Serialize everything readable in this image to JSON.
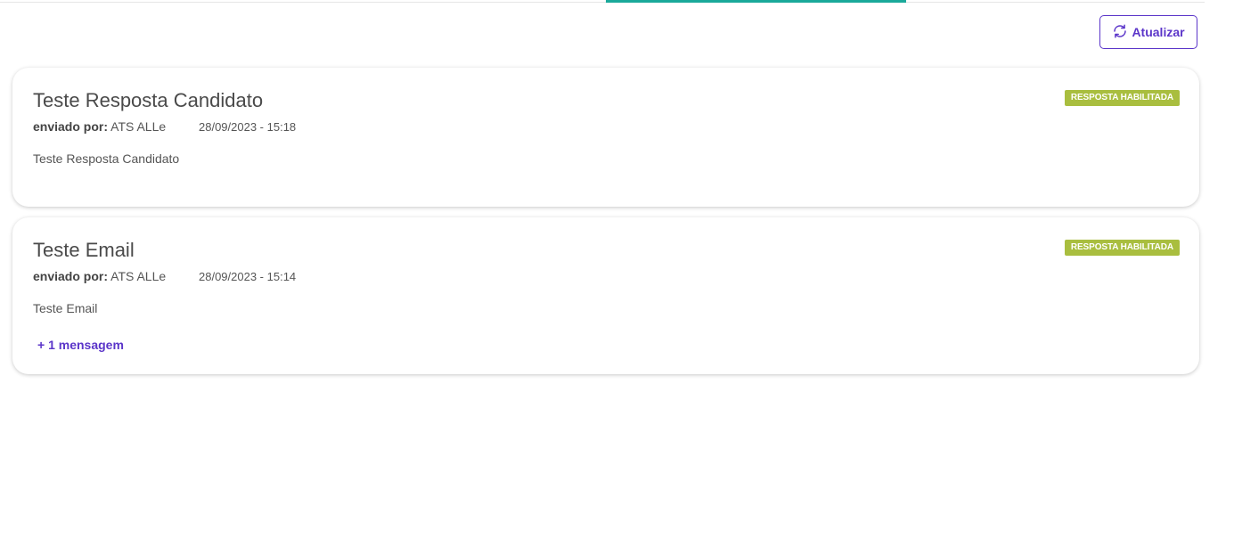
{
  "toolbar": {
    "refresh_label": "Atualizar",
    "refresh_icon": "refresh-icon"
  },
  "colors": {
    "accent": "#5b35c9",
    "tab_indicator": "#1aa99a",
    "badge": "#a9be3f"
  },
  "messages": [
    {
      "title": "Teste Resposta Candidato",
      "sent_by_label": "enviado por:",
      "sender": "ATS ALLe",
      "datetime": "28/09/2023 - 15:18",
      "badge": "RESPOSTA HABILITADA",
      "body": "Teste Resposta Candidato"
    },
    {
      "title": "Teste Email",
      "sent_by_label": "enviado por:",
      "sender": "ATS ALLe",
      "datetime": "28/09/2023 - 15:14",
      "badge": "RESPOSTA HABILITADA",
      "body": "Teste Email",
      "more_link": "+ 1 mensagem"
    }
  ]
}
